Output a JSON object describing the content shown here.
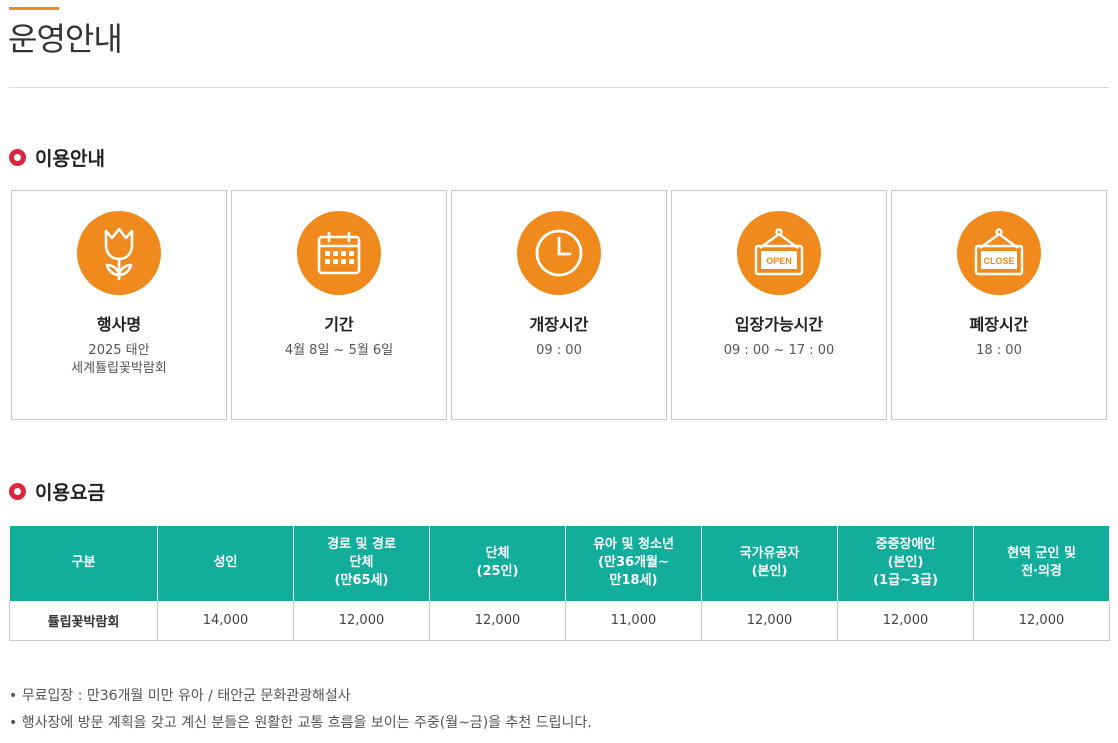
{
  "page": {
    "title": "운영안내"
  },
  "sections": {
    "info_title": "이용안내",
    "fee_title": "이용요금"
  },
  "cards": [
    {
      "icon": "tulip-icon",
      "label": "행사명",
      "value_lines": [
        "2025 태안",
        "세계튤립꽃박람회"
      ]
    },
    {
      "icon": "calendar-icon",
      "label": "기간",
      "value_lines": [
        "4월 8일 ~ 5월 6일"
      ]
    },
    {
      "icon": "clock-icon",
      "label": "개장시간",
      "value_lines": [
        "09 : 00"
      ]
    },
    {
      "icon": "open-sign-icon",
      "label": "입장가능시간",
      "value_lines": [
        "09 : 00 ~ 17 : 00"
      ]
    },
    {
      "icon": "close-sign-icon",
      "label": "폐장시간",
      "value_lines": [
        "18 : 00"
      ]
    }
  ],
  "sign_text": {
    "open": "OPEN",
    "close": "CLOSE"
  },
  "fee_table": {
    "headers": [
      "구분",
      "성인",
      "경로 및 경로\n단체\n(만65세)",
      "단체\n(25인)",
      "유아 및 청소년\n(만36개월~\n만18세)",
      "국가유공자\n(본인)",
      "중증장애인\n(본인)\n(1급~3급)",
      "현역 군인 및\n전·의경"
    ],
    "rows": [
      [
        "튤립꽃박람회",
        "14,000",
        "12,000",
        "12,000",
        "11,000",
        "12,000",
        "12,000",
        "12,000"
      ]
    ]
  },
  "notes": [
    "무료입장 : 만36개월 미만 유아 / 태안군 문화관광해설사",
    "행사장에 방문 계획을 갖고 계신 분들은 원활한 교통 흐름을 보이는 주중(월~금)을 추천 드립니다."
  ],
  "colors": {
    "accent": "#f18a1c",
    "table_header": "#13ad9c",
    "section_bullet": "#d9273f"
  }
}
